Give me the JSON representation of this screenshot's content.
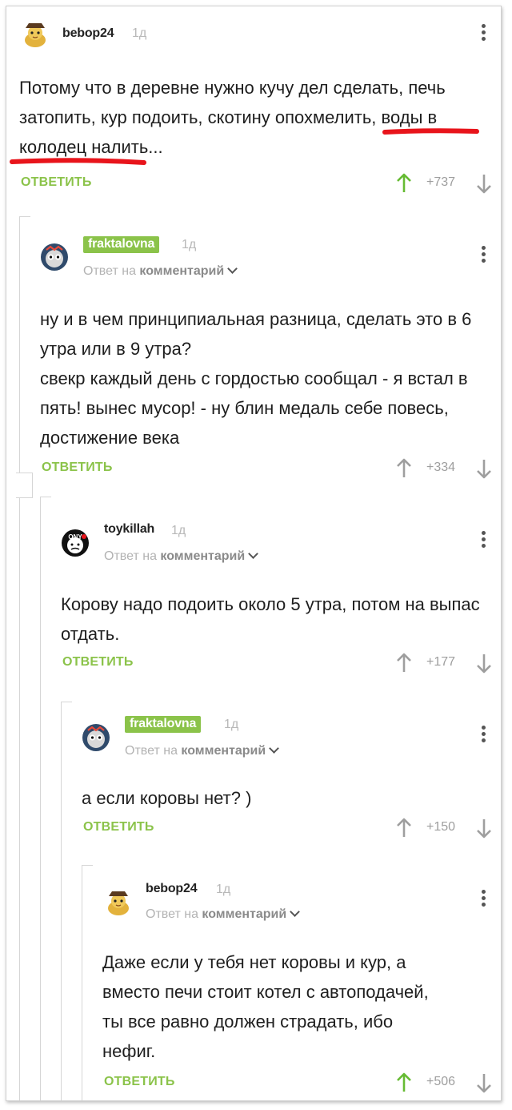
{
  "reply_label": "ОТВЕТИТЬ",
  "reply_to_prefix": "Ответ на",
  "reply_to_target": "комментарий",
  "comments": [
    {
      "username": "bebop24",
      "time": "1д",
      "text": "Потому что в деревне нужно кучу дел сделать, печь затопить, кур подоить, скотину опохмелить, воды в колодец налить...",
      "score": "+737",
      "avatar": "cat-pirate-avatar"
    },
    {
      "username": "fraktalovna",
      "time": "1д",
      "text": "ну и в чем принципиальная разница, сделать это в 6 утра или в 9 утра?\nсвекр каждый день с гордостью сообщал - я встал в пять! вынес мусор! - ну блин медаль себе повесь, достижение века",
      "score": "+334",
      "avatar": "owl-avatar"
    },
    {
      "username": "toykillah",
      "time": "1д",
      "text": "Корову надо подоить около 5 утра, потом на выпас отдать.",
      "score": "+177",
      "avatar": "ony-avatar"
    },
    {
      "username": "fraktalovna",
      "time": "1д",
      "text": "а если коровы нет? )",
      "score": "+150",
      "avatar": "owl-avatar"
    },
    {
      "username": "bebop24",
      "time": "1д",
      "text": "Даже если у тебя нет коровы и кур, а вместо печи стоит котел с автоподачей, ты все равно должен страдать, ибо нефиг.",
      "score": "+506",
      "avatar": "cat-pirate-avatar"
    }
  ],
  "colors": {
    "accent_green": "#8bc34a",
    "upvote_active": "#66bb33",
    "highlight_red": "#e8141b"
  }
}
